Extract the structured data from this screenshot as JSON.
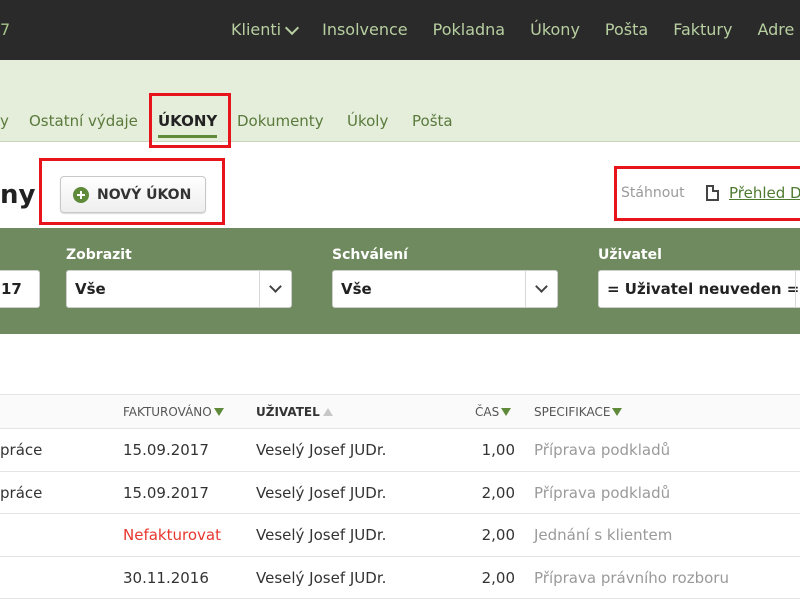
{
  "topbar": {
    "left_fragment": "7",
    "nav": [
      {
        "label": "Klienti",
        "dropdown": true
      },
      {
        "label": "Insolvence"
      },
      {
        "label": "Pokladna"
      },
      {
        "label": "Úkony"
      },
      {
        "label": "Pošta"
      },
      {
        "label": "Faktury"
      },
      {
        "label": "Adre"
      }
    ]
  },
  "subnav": {
    "tabs": [
      {
        "label": "y"
      },
      {
        "label": "Ostatní výdaje"
      },
      {
        "label": "ÚKONY",
        "active": true
      },
      {
        "label": "Dokumenty"
      },
      {
        "label": "Úkoly"
      },
      {
        "label": "Pošta"
      }
    ]
  },
  "page": {
    "title_fragment": "ny",
    "new_button": "NOVÝ ÚKON",
    "download_label": "Stáhnout",
    "download_link": "Přehled D"
  },
  "filters": {
    "date_value": "17",
    "zobrazit": {
      "label": "Zobrazit",
      "value": "Vše"
    },
    "schvaleni": {
      "label": "Schválení",
      "value": "Vše"
    },
    "uzivatel": {
      "label": "Uživatel",
      "value": "= Uživatel neuveden ="
    }
  },
  "table": {
    "headers": {
      "fakturovano": "FAKTUROVÁNO",
      "uzivatel": "UŽIVATEL",
      "cas": "ČAS",
      "specifikace": "SPECIFIKACE"
    },
    "rows": [
      {
        "type": "práce",
        "invoiced": "15.09.2017",
        "user": "Veselý Josef JUDr.",
        "time": "1,00",
        "spec": "Příprava podkladů"
      },
      {
        "type": "práce",
        "invoiced": "15.09.2017",
        "user": "Veselý Josef JUDr.",
        "time": "2,00",
        "spec": "Příprava podkladů"
      },
      {
        "type": "",
        "invoiced": "Nefakturovat",
        "user": "Veselý Josef JUDr.",
        "time": "2,00",
        "spec": "Jednání s klientem"
      },
      {
        "type": "",
        "invoiced": "30.11.2016",
        "user": "Veselý Josef JUDr.",
        "time": "2,00",
        "spec": "Příprava právního rozboru"
      }
    ]
  },
  "colors": {
    "accent_green": "#5e8a3a",
    "filterbar": "#6f8a5e",
    "highlight_red": "#e8141c",
    "not_invoiced_red": "#e8372e"
  }
}
